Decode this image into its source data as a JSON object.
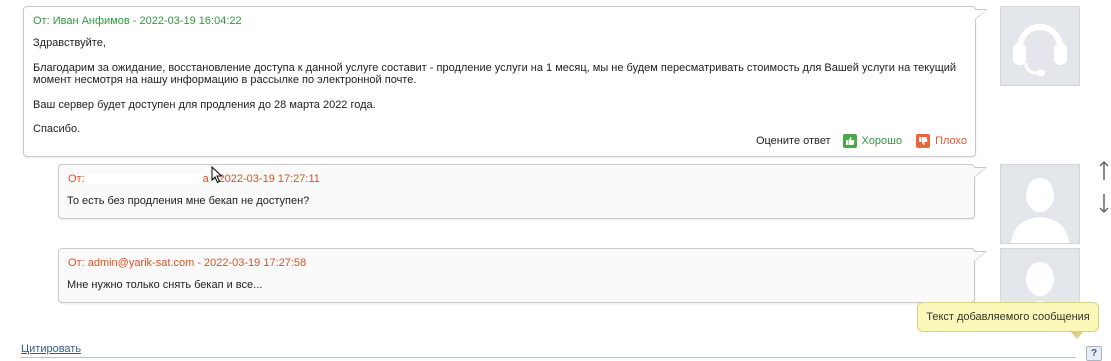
{
  "messages": [
    {
      "header": "От: Иван Анфимов - 2022-03-19 16:04:22",
      "paragraphs": [
        "Здравствуйте,",
        "Благодарим за ожидание, восстановление доступа к данной услуге составит - продление услуги на 1 месяц, мы не будем пересматривать стоимость для Вашей услуги на текущий момент несмотря на нашу информацию в рассылке по электронной почте.",
        "Ваш сервер будет доступен для продления до 28 марта 2022 года.",
        "Спасибо."
      ],
      "rating": {
        "label": "Оцените ответ",
        "good": "Хорошо",
        "bad": "Плохо"
      }
    },
    {
      "header_prefix": "От:",
      "header_suffix": "а - 2022-03-19 17:27:11",
      "text": "То есть без продления мне бекап не доступен?"
    },
    {
      "header": "От: admin@yarik-sat.com - 2022-03-19 17:27:58",
      "text": "Мне нужно только снять бекап и все..."
    }
  ],
  "tooltip": "Текст добавляемого сообщения",
  "help": "?",
  "quote_link": "Цитировать",
  "colors": {
    "green": "#2e9a3c",
    "red": "#d9532a",
    "tooltip_bg": "#fbf7b8"
  }
}
